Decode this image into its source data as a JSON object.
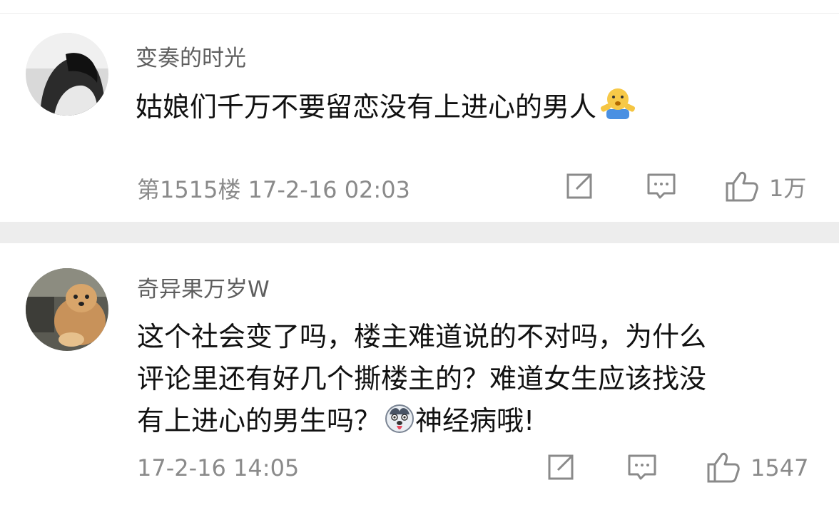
{
  "comments": [
    {
      "username": "变奏的时光",
      "text": "姑娘们千万不要留恋没有上进心的男人",
      "emoji": "shrug-emoji",
      "floor": "第1515楼",
      "time": "17-2-16 02:03",
      "likes": "1万"
    },
    {
      "username": "奇异果万岁W",
      "lines": [
        "这个社会变了吗，楼主难道说的不对吗，为什么",
        "评论里还有好几个撕楼主的？难道女生应该找没",
        "有上进心的男生吗？"
      ],
      "emoji": "husky-dog-emoji",
      "after_emoji": "神经病哦!",
      "time": "17-2-16 14:05",
      "likes": "1547"
    }
  ],
  "icons": {
    "share": "share-edit-icon",
    "reply": "comment-bubble-icon",
    "like": "thumbs-up-icon"
  },
  "colors": {
    "username": "#5e5e5e",
    "text": "#111111",
    "meta": "#8a8a8a",
    "separator": "#ededed"
  }
}
